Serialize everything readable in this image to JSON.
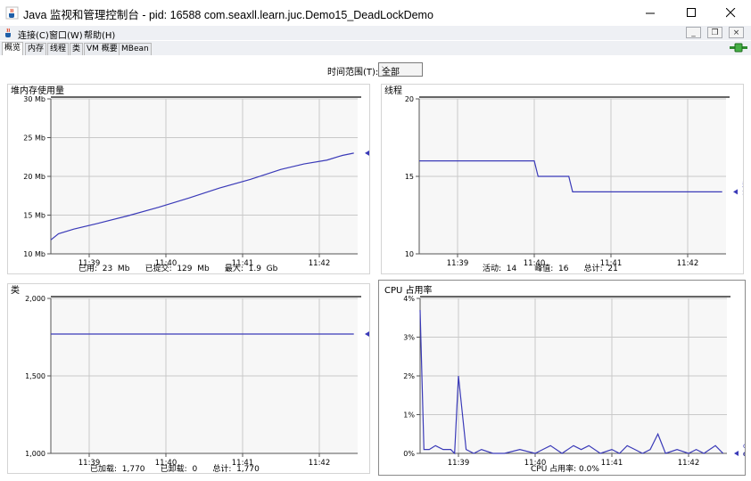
{
  "window": {
    "title": "Java 监视和管理控制台 - pid: 16588 com.seaxll.learn.juc.Demo15_DeadLockDemo"
  },
  "menu": {
    "items": [
      "连接(C)",
      "窗口(W)",
      "帮助(H)"
    ]
  },
  "tabs": [
    "概览",
    "内存",
    "线程",
    "类",
    "VM 概要",
    "MBean"
  ],
  "time_range": {
    "label": "时间范围(T):",
    "value": "全部"
  },
  "panels": {
    "heap": {
      "title": "堆内存使用量",
      "legend_name": "已用",
      "legend_value": "23,003,448",
      "stats": "已用:  23  Mb      已提交:  129  Mb      最大:  1.9  Gb"
    },
    "threads": {
      "title": "线程",
      "legend_name": "活动线程",
      "legend_value": "14",
      "stats": "活动:  14       峰值:  16      总计:  21"
    },
    "classes": {
      "title": "类",
      "legend_name": "已加载",
      "legend_value": "1,770",
      "stats": "已加载:  1,770      已卸载:  0      总计:  1,770"
    },
    "cpu": {
      "title": "CPU 占用率",
      "legend_name": "CPU 占用率",
      "legend_value": "0.0%",
      "stats": "CPU 占用率: 0.0%"
    }
  },
  "chart_data": [
    {
      "type": "line",
      "title": "堆内存使用量",
      "x_ticks": [
        "11:39",
        "11:40",
        "11:41",
        "11:42"
      ],
      "y_ticks": [
        "10 Mb",
        "15 Mb",
        "20 Mb",
        "25 Mb",
        "30 Mb"
      ],
      "ylim": [
        10,
        30
      ],
      "xlim": [
        0,
        4
      ],
      "series": [
        {
          "name": "已用",
          "color": "#3a3ab8",
          "x": [
            0,
            0.1,
            0.3,
            0.6,
            1.0,
            1.4,
            1.8,
            2.2,
            2.6,
            3.0,
            3.3,
            3.6,
            3.8,
            3.95
          ],
          "y": [
            11.8,
            12.6,
            13.2,
            13.9,
            14.9,
            16.0,
            17.2,
            18.5,
            19.6,
            20.9,
            21.6,
            22.1,
            22.7,
            23.0
          ]
        }
      ],
      "grid": true
    },
    {
      "type": "line",
      "title": "线程",
      "x_ticks": [
        "11:39",
        "11:40",
        "11:41",
        "11:42"
      ],
      "y_ticks": [
        "10",
        "15",
        "20"
      ],
      "ylim": [
        10,
        20
      ],
      "xlim": [
        0,
        4
      ],
      "series": [
        {
          "name": "活动线程",
          "color": "#3a3ab8",
          "x": [
            0,
            1.5,
            1.55,
            1.95,
            2.0,
            3.95
          ],
          "y": [
            16,
            16,
            15,
            15,
            14,
            14
          ]
        }
      ],
      "grid": true
    },
    {
      "type": "line",
      "title": "类",
      "x_ticks": [
        "11:39",
        "11:40",
        "11:41",
        "11:42"
      ],
      "y_ticks": [
        "1,000",
        "1,500",
        "2,000"
      ],
      "ylim": [
        1000,
        2000
      ],
      "xlim": [
        0,
        4
      ],
      "series": [
        {
          "name": "已加载",
          "color": "#3a3ab8",
          "x": [
            0,
            3.95
          ],
          "y": [
            1770,
            1770
          ]
        }
      ],
      "grid": true
    },
    {
      "type": "line",
      "title": "CPU 占用率",
      "x_ticks": [
        "11:39",
        "11:40",
        "11:41",
        "11:42"
      ],
      "y_ticks": [
        "0%",
        "1%",
        "2%",
        "3%",
        "4%"
      ],
      "ylim": [
        0,
        4
      ],
      "xlim": [
        0,
        4
      ],
      "series": [
        {
          "name": "CPU 占用率",
          "color": "#3a3ab8",
          "x": [
            0.0,
            0.05,
            0.12,
            0.2,
            0.3,
            0.4,
            0.45,
            0.5,
            0.6,
            0.7,
            0.8,
            0.95,
            1.1,
            1.3,
            1.5,
            1.6,
            1.7,
            1.85,
            2.0,
            2.1,
            2.2,
            2.35,
            2.5,
            2.6,
            2.7,
            2.8,
            2.9,
            3.0,
            3.1,
            3.2,
            3.35,
            3.5,
            3.6,
            3.7,
            3.85,
            3.95
          ],
          "y": [
            3.7,
            0.1,
            0.1,
            0.2,
            0.1,
            0.1,
            0.0,
            2.0,
            0.1,
            0.0,
            0.1,
            0.0,
            0.0,
            0.1,
            0.0,
            0.1,
            0.2,
            0.0,
            0.2,
            0.1,
            0.2,
            0.0,
            0.1,
            0.0,
            0.2,
            0.1,
            0.0,
            0.1,
            0.5,
            0.0,
            0.1,
            0.0,
            0.1,
            0.0,
            0.2,
            0.0
          ]
        }
      ],
      "grid": true
    }
  ]
}
